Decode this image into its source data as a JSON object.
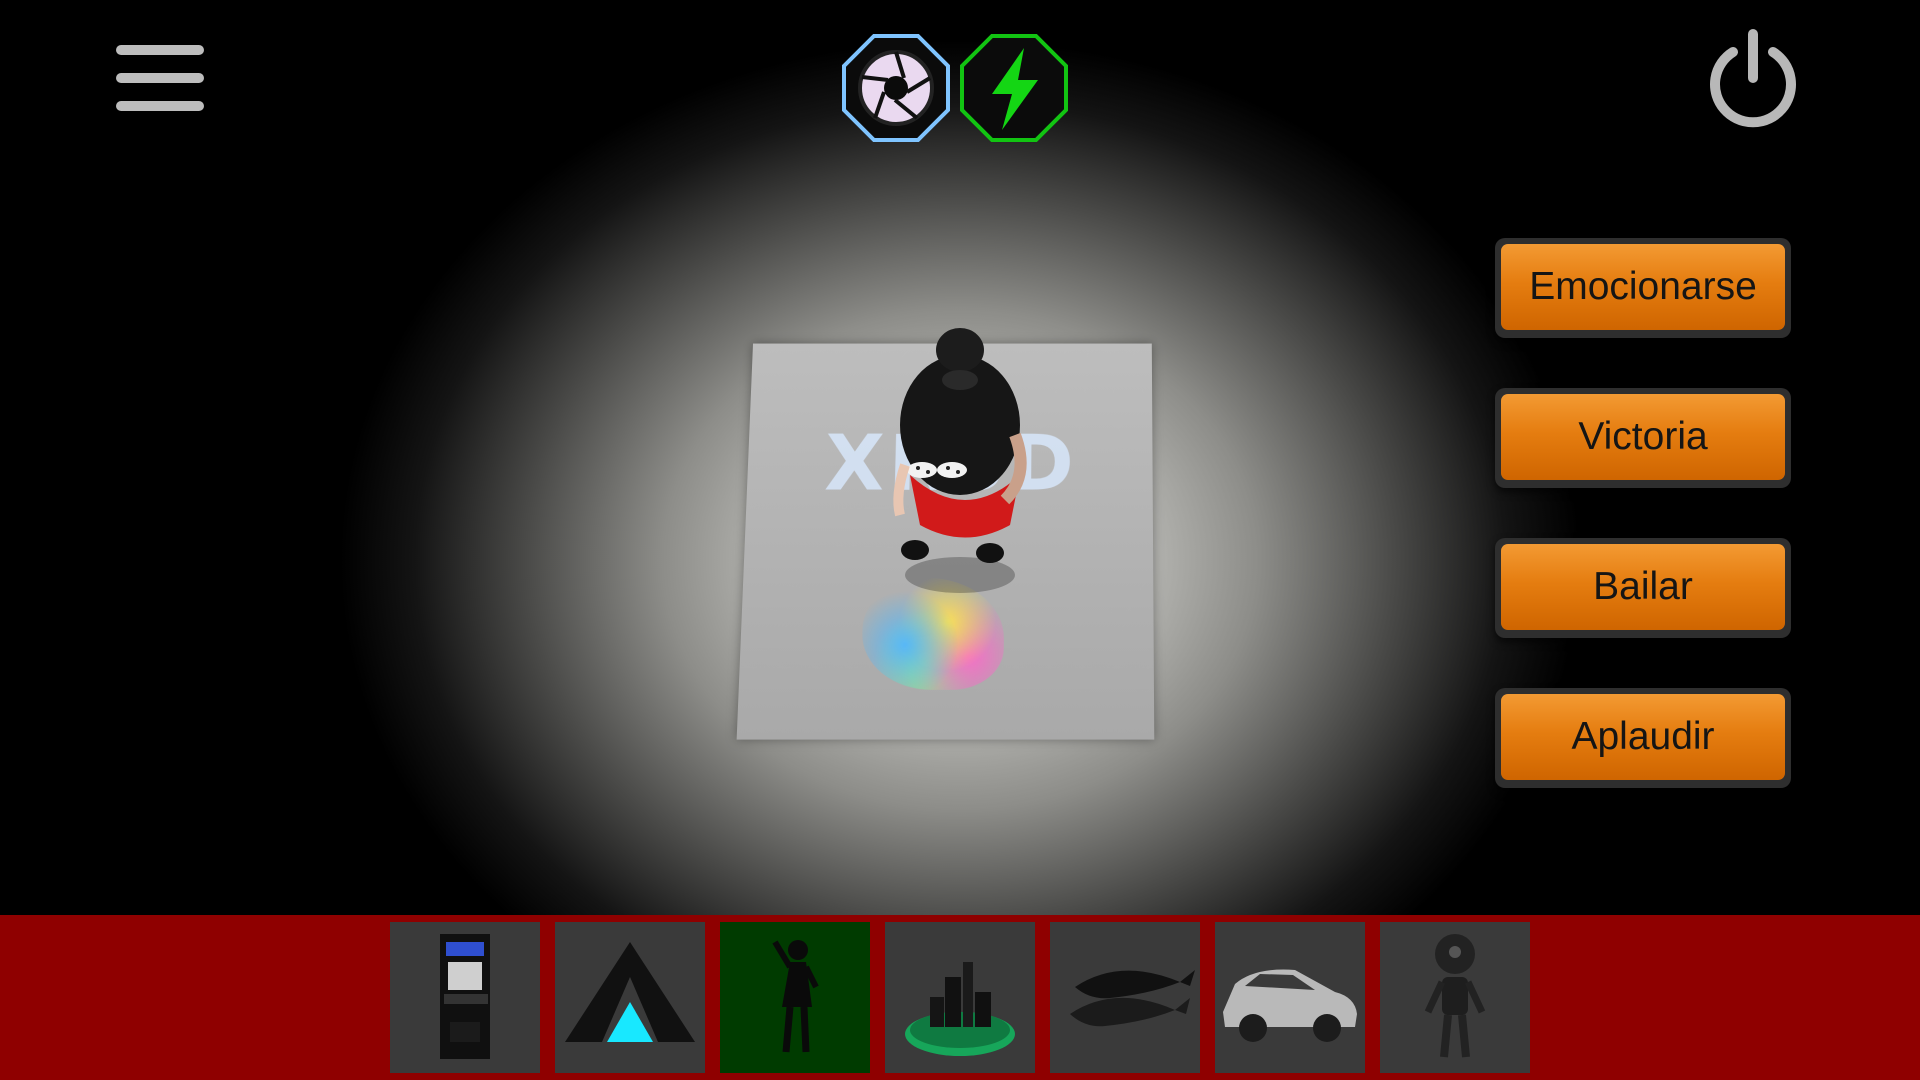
{
  "toolbar": {
    "menu_icon": "hamburger-menu-icon",
    "camera_icon": "camera-shutter-icon",
    "flash_icon": "lightning-bolt-icon",
    "power_icon": "power-icon",
    "camera_color": "#7fc4ff",
    "flash_color": "#12c412"
  },
  "scene": {
    "marker_text": "XR3D"
  },
  "actions": [
    {
      "label": "Emocionarse"
    },
    {
      "label": "Victoria"
    },
    {
      "label": "Bailar"
    },
    {
      "label": "Aplaudir"
    }
  ],
  "tray": {
    "background": "#8f0000",
    "items": [
      {
        "icon": "arcade-machine-icon",
        "selected": false
      },
      {
        "icon": "triangle-logo-icon",
        "selected": false
      },
      {
        "icon": "girl-character-icon",
        "selected": true
      },
      {
        "icon": "city-island-icon",
        "selected": false
      },
      {
        "icon": "whales-icon",
        "selected": false
      },
      {
        "icon": "car-icon",
        "selected": false
      },
      {
        "icon": "robot-icon",
        "selected": false
      }
    ]
  }
}
